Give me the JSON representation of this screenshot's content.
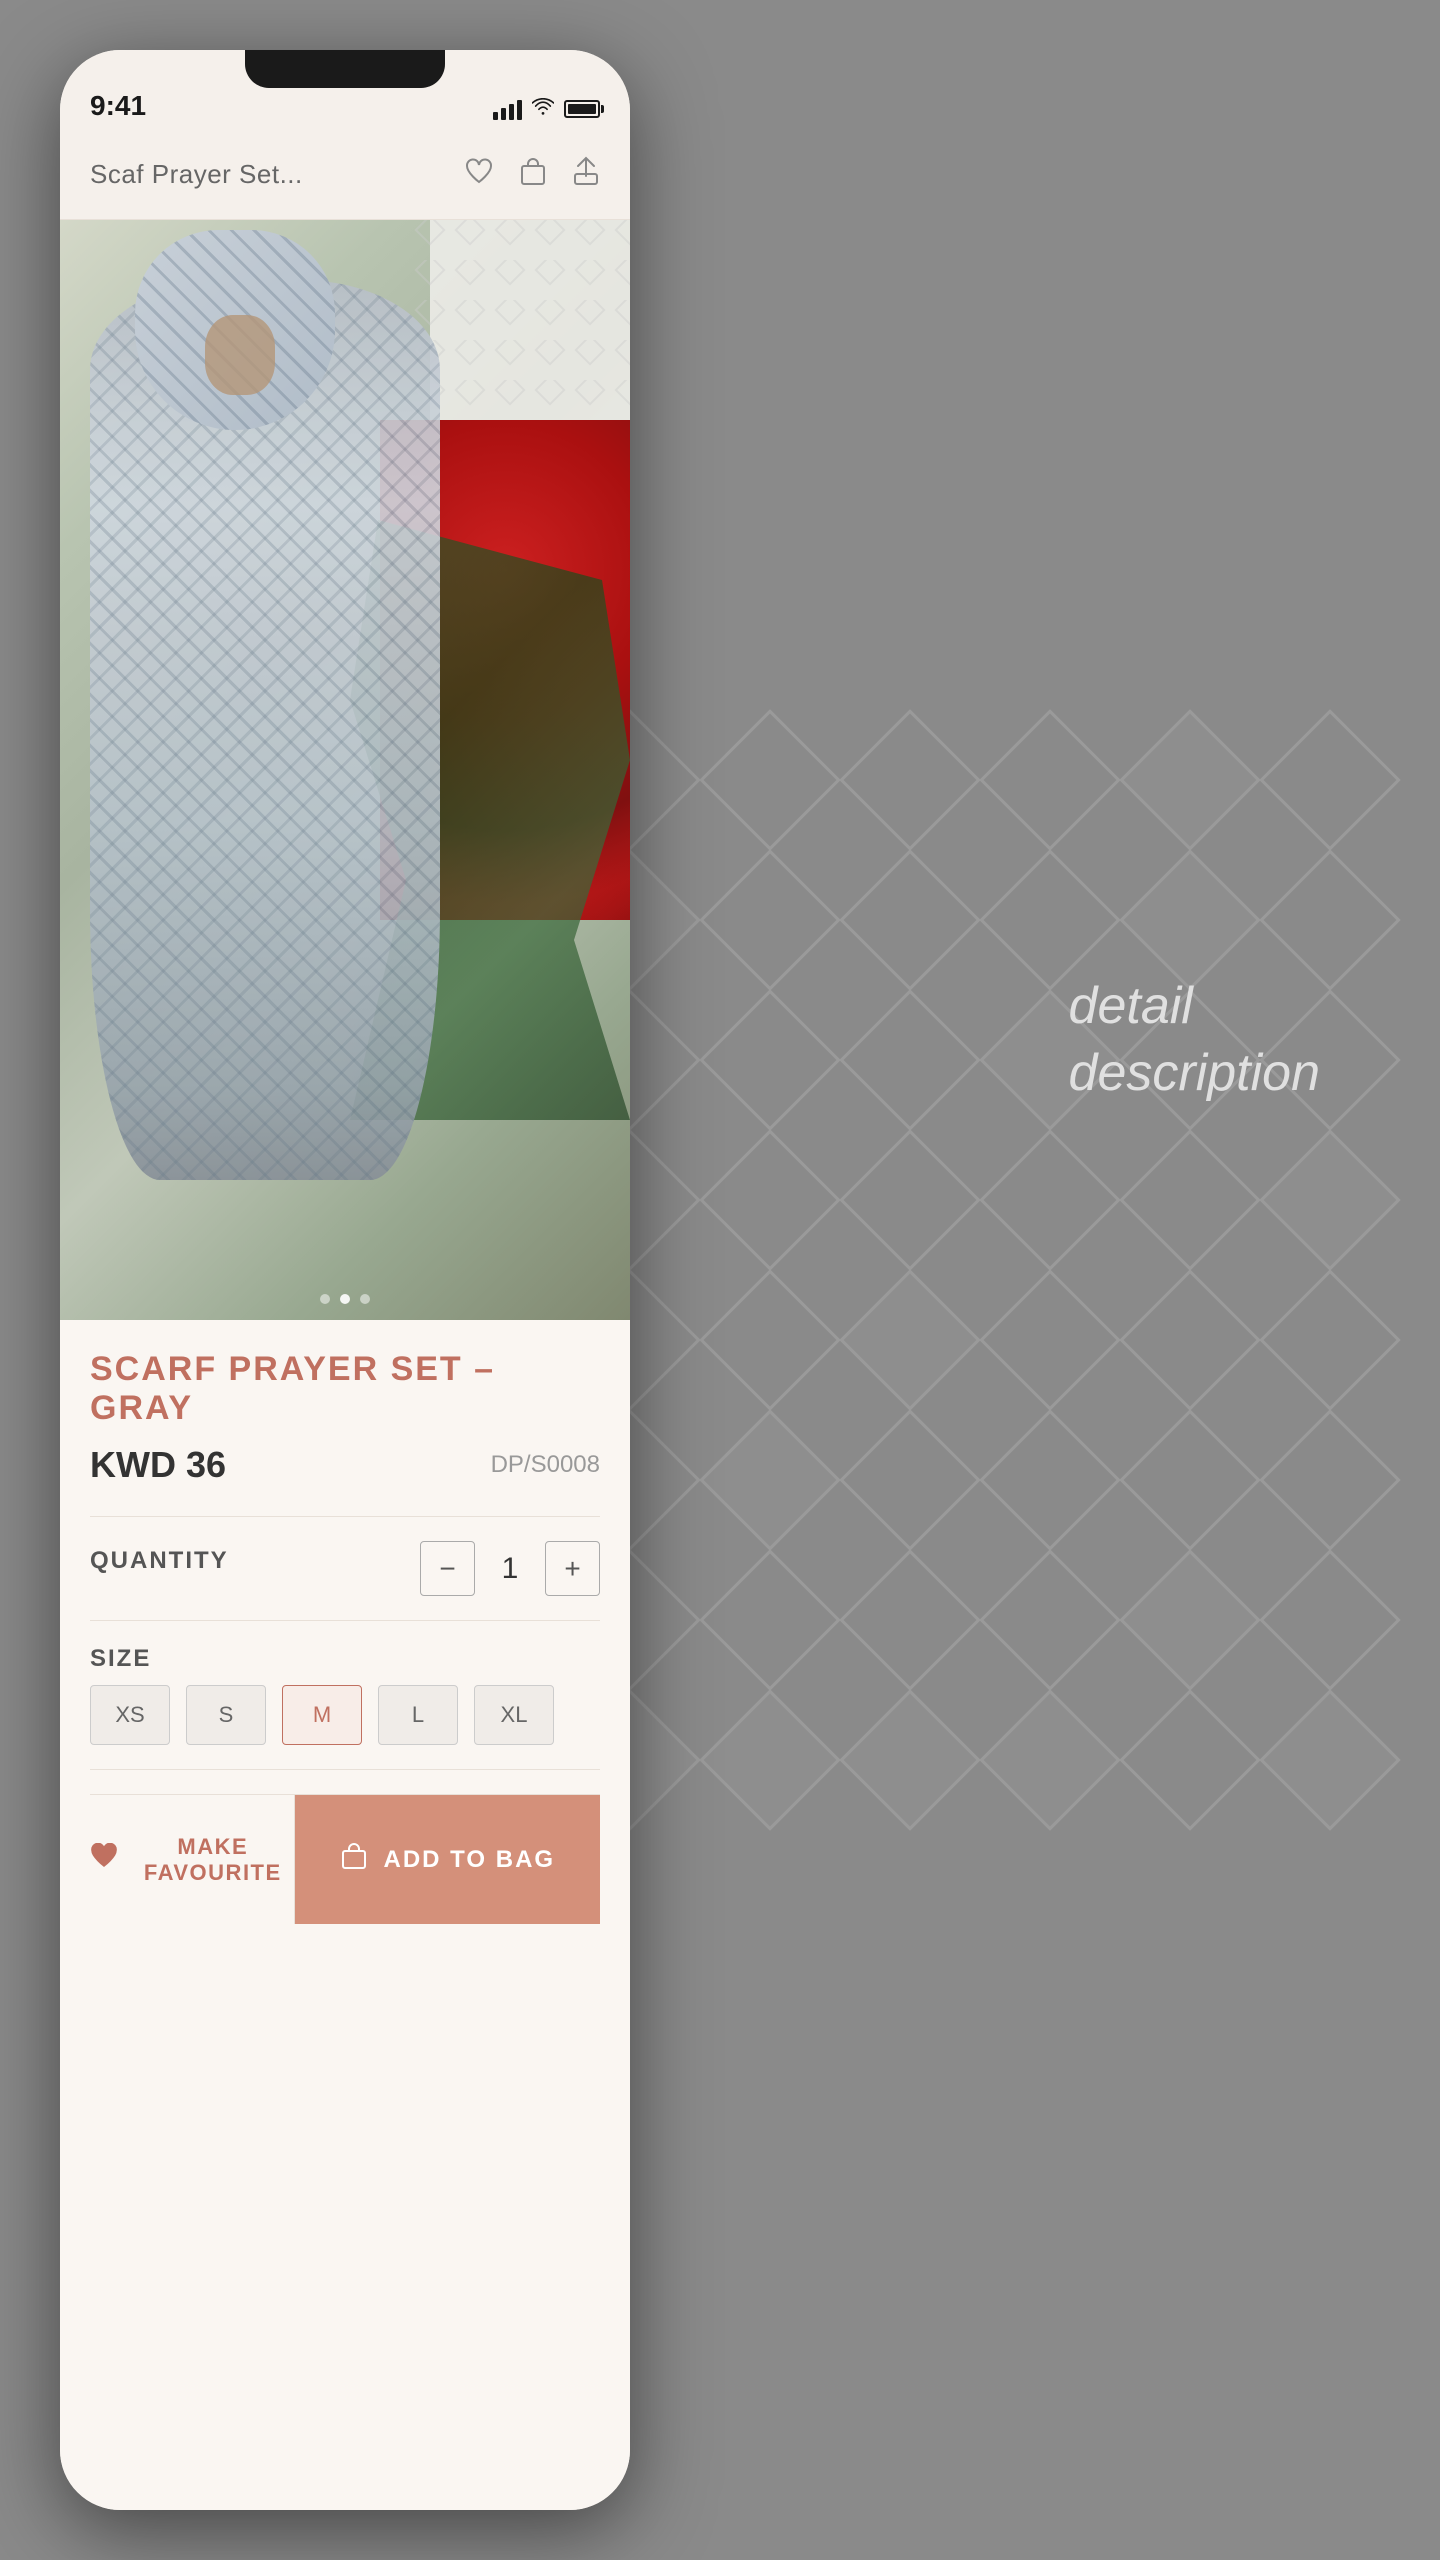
{
  "page": {
    "background_color": "#8a8a8a"
  },
  "status_bar": {
    "time": "9:41",
    "signal_label": "signal",
    "wifi_label": "wifi",
    "battery_label": "battery"
  },
  "nav": {
    "title": "Scaf Prayer Set...",
    "favourite_icon": "heart-icon",
    "bag_icon": "bag-icon",
    "share_icon": "share-icon"
  },
  "product": {
    "name": "SCARF PRAYER SET – GRAY",
    "price": "KWD 36",
    "sku": "DP/S0008",
    "quantity_label": "QUANTITY",
    "quantity_value": "1",
    "size_label": "SIZE",
    "sizes": [
      "XS",
      "S",
      "M",
      "L",
      "XL"
    ],
    "selected_size": "M",
    "image_dots": [
      {
        "active": false
      },
      {
        "active": true
      },
      {
        "active": false
      }
    ]
  },
  "buttons": {
    "favourite_label": "MAKE FAVOURITE",
    "add_to_bag_label": "ADD TO BAG"
  },
  "detail_description": {
    "line1": "detail",
    "line2": "description"
  }
}
